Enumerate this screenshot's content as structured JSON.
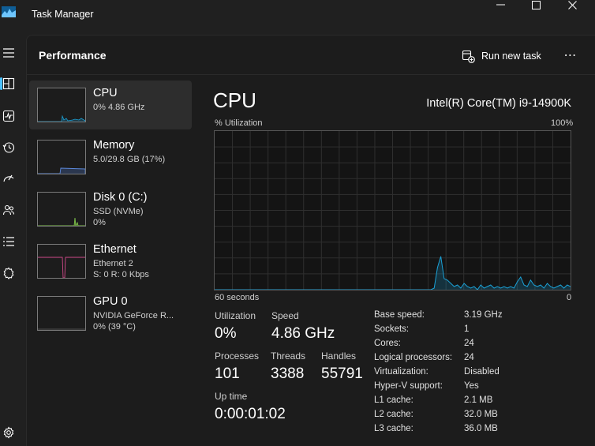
{
  "window": {
    "title": "Task Manager",
    "accent": "#4cc2ff",
    "graph_color": "#1ba1d6"
  },
  "header": {
    "page_title": "Performance",
    "run_new_task": "Run new task",
    "more": "⋯"
  },
  "rail": {
    "icons": [
      "hamburger-icon",
      "processes-icon",
      "performance-icon",
      "app-history-icon",
      "startup-apps-icon",
      "users-icon",
      "details-icon",
      "services-icon",
      "settings-icon"
    ],
    "active": "performance-icon"
  },
  "resources": [
    {
      "name": "CPU",
      "sub1": "0%  4.86 GHz",
      "sub2": ""
    },
    {
      "name": "Memory",
      "sub1": "5.0/29.8 GB (17%)",
      "sub2": ""
    },
    {
      "name": "Disk 0 (C:)",
      "sub1": "SSD (NVMe)",
      "sub2": "0%"
    },
    {
      "name": "Ethernet",
      "sub1": "Ethernet 2",
      "sub2": "S: 0  R: 0 Kbps"
    },
    {
      "name": "GPU 0",
      "sub1": "NVIDIA GeForce R...",
      "sub2": "0%  (39 °C)"
    }
  ],
  "detail": {
    "title": "CPU",
    "model": "Intel(R) Core(TM) i9-14900K",
    "util_label": "% Utilization",
    "util_max": "100%",
    "x_left": "60 seconds",
    "x_right": "0",
    "edge_cut": "l"
  },
  "stats": {
    "utilization_label": "Utilization",
    "utilization_value": "0%",
    "speed_label": "Speed",
    "speed_value": "4.86 GHz",
    "processes_label": "Processes",
    "processes_value": "101",
    "threads_label": "Threads",
    "threads_value": "3388",
    "handles_label": "Handles",
    "handles_value": "55791",
    "uptime_label": "Up time",
    "uptime_value": "0:00:01:02"
  },
  "specs": [
    {
      "label": "Base speed:",
      "value": "3.19 GHz"
    },
    {
      "label": "Sockets:",
      "value": "1"
    },
    {
      "label": "Cores:",
      "value": "24"
    },
    {
      "label": "Logical processors:",
      "value": "24"
    },
    {
      "label": "Virtualization:",
      "value": "Disabled"
    },
    {
      "label": "Hyper-V support:",
      "value": "Yes"
    },
    {
      "label": "L1 cache:",
      "value": "2.1 MB"
    },
    {
      "label": "L2 cache:",
      "value": "32.0 MB"
    },
    {
      "label": "L3 cache:",
      "value": "36.0 MB"
    }
  ],
  "cpu_history": [
    0,
    0,
    0,
    0,
    0,
    0,
    0,
    0,
    0,
    0,
    0,
    0,
    0,
    0,
    0,
    0,
    0,
    0,
    0,
    0,
    0,
    0,
    0,
    0,
    0,
    0,
    0,
    0,
    0,
    0,
    0,
    0,
    0,
    0,
    0,
    0,
    0,
    0,
    0,
    0,
    0,
    0,
    0,
    0,
    0,
    0,
    0,
    0,
    0,
    0,
    0,
    0,
    0,
    0,
    0,
    0,
    0,
    0,
    0,
    0,
    0,
    0,
    0,
    0,
    0,
    0,
    0,
    0,
    0,
    0,
    0,
    0,
    0,
    0,
    0,
    0,
    0,
    0,
    0,
    0,
    0,
    0,
    0,
    0,
    0,
    0,
    0,
    0,
    0,
    0,
    0,
    0,
    0,
    0,
    0,
    0,
    0,
    0,
    0,
    0,
    0,
    0,
    0,
    0,
    0,
    0,
    0,
    0,
    0,
    0,
    0,
    0,
    0,
    0,
    0,
    0,
    0,
    0,
    0,
    0,
    0,
    0,
    0,
    0,
    0,
    0,
    0,
    0,
    0,
    0,
    0,
    0,
    0,
    0,
    0,
    0,
    0,
    0,
    0,
    0,
    0,
    0,
    0,
    0,
    0,
    0,
    0,
    0,
    0,
    0,
    0,
    0,
    0,
    0,
    0,
    0,
    0,
    0,
    0,
    0,
    0,
    0,
    0,
    0,
    0,
    0,
    0,
    0,
    0,
    0,
    0,
    0,
    0,
    0,
    0,
    0,
    0,
    0,
    0,
    0,
    0,
    0,
    0,
    0,
    0,
    0,
    0,
    0,
    0,
    0,
    0,
    0,
    0,
    0,
    0,
    0,
    0,
    0,
    0,
    0,
    0,
    0,
    0,
    0,
    0,
    0,
    0,
    0,
    0,
    0,
    0,
    0,
    0,
    0,
    0,
    0,
    0,
    0,
    0,
    0,
    0,
    0,
    0,
    0,
    0,
    0,
    0,
    0,
    0,
    0,
    0,
    0,
    0,
    0,
    0,
    0,
    0,
    0,
    0,
    0,
    0,
    0,
    0,
    0,
    0,
    0,
    0,
    0,
    0,
    0,
    0,
    0,
    0,
    0,
    0,
    0,
    0,
    0,
    0,
    0,
    0,
    0,
    0,
    0,
    0,
    0,
    0,
    0,
    0,
    0,
    0,
    0,
    0,
    0,
    0,
    0,
    0,
    0,
    0,
    0,
    0,
    0,
    0,
    0,
    0,
    0,
    0,
    0,
    0,
    0,
    0,
    0,
    0,
    0,
    0,
    0,
    0,
    0,
    0,
    0,
    0,
    0,
    0,
    0,
    0,
    0,
    0,
    0,
    0,
    0,
    0,
    0,
    0,
    0,
    0,
    0,
    0,
    0,
    0,
    0,
    0,
    0,
    0,
    0,
    0,
    0,
    0,
    0,
    0,
    0,
    0,
    0,
    0,
    0,
    0,
    0,
    0,
    0,
    0,
    0,
    0,
    0,
    0,
    0,
    0,
    0,
    0,
    0,
    0,
    0,
    0,
    0,
    0,
    0,
    0,
    0,
    0,
    0,
    0,
    0,
    0,
    0,
    0,
    0,
    0,
    0,
    0,
    0,
    0,
    0,
    0,
    0,
    0,
    0,
    0,
    0,
    0,
    0,
    0,
    0,
    0,
    0,
    0,
    0,
    0,
    0,
    0,
    0,
    0,
    0,
    0,
    0,
    0,
    0,
    0,
    0,
    0,
    0,
    0,
    0,
    0,
    0,
    0,
    0,
    0,
    0,
    0,
    0,
    0,
    0,
    0,
    0,
    0,
    0,
    0,
    0,
    0,
    0,
    0,
    0,
    0,
    0,
    0,
    0,
    0,
    0,
    0,
    0,
    0,
    0,
    0,
    0,
    0,
    0,
    0,
    0,
    0,
    0,
    0,
    0,
    0,
    0,
    0,
    0,
    0,
    0,
    0,
    0,
    0,
    0,
    0,
    0,
    0,
    0,
    0,
    0,
    0,
    0,
    0,
    0,
    0,
    0,
    0,
    0,
    0,
    0,
    0,
    0,
    0,
    0,
    0,
    0,
    0,
    0,
    0,
    0,
    0,
    0,
    0,
    0,
    0,
    0,
    0,
    0,
    0,
    0,
    0,
    0,
    0,
    0,
    0,
    0,
    0,
    0,
    0,
    0,
    0,
    0,
    0,
    0,
    0,
    0,
    0,
    0
  ]
}
